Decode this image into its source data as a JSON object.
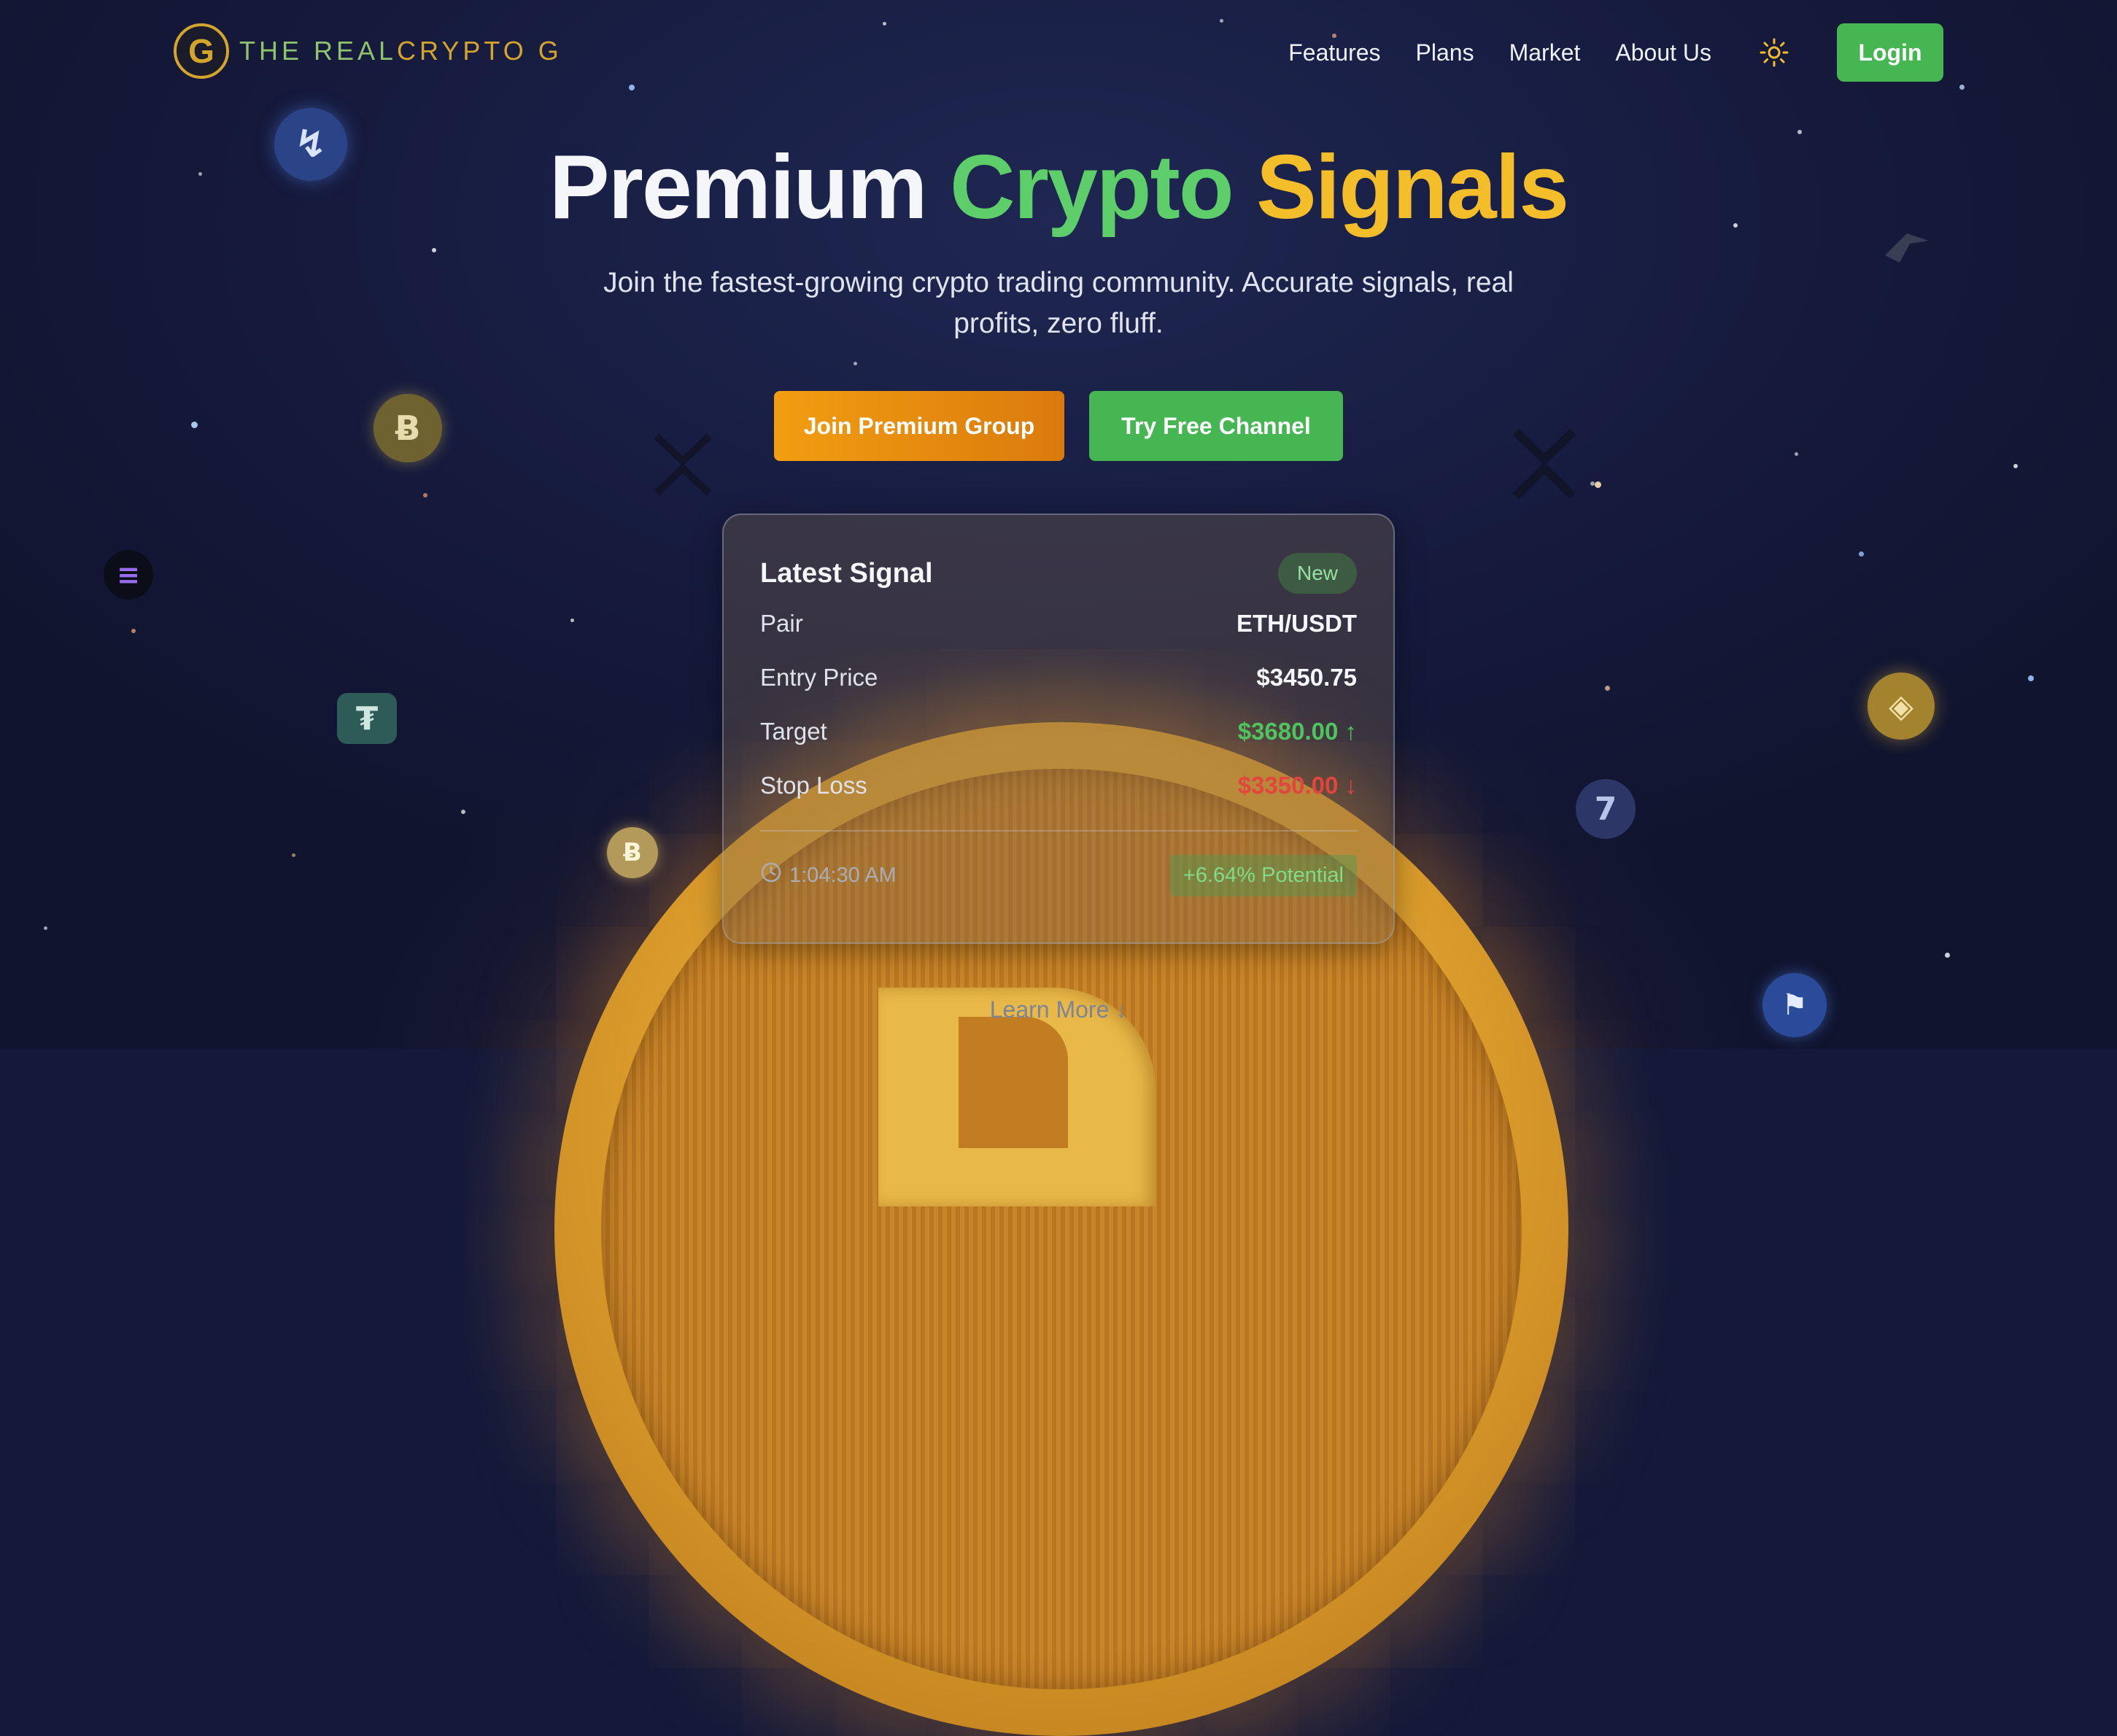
{
  "brand": {
    "logo_mark": "G",
    "name_part1": "THE REAL",
    "name_part2": "CRYPTO G"
  },
  "nav": {
    "links": [
      "Features",
      "Plans",
      "Market",
      "About Us"
    ],
    "theme_icon": "sun-icon",
    "login_label": "Login"
  },
  "hero": {
    "title_part1": "Premium",
    "title_part2": "Crypto",
    "title_part3": "Signals",
    "subtitle": "Join the fastest-growing crypto trading community. Accurate signals, real profits, zero fluff.",
    "primary_cta": "Join Premium Group",
    "secondary_cta": "Try Free Channel"
  },
  "signal": {
    "title": "Latest Signal",
    "badge": "New",
    "rows": [
      {
        "label": "Pair",
        "value": "ETH/USDT"
      },
      {
        "label": "Entry Price",
        "value": "$3450.75"
      },
      {
        "label": "Target",
        "value": "$3680.00 ↑"
      },
      {
        "label": "Stop Loss",
        "value": "$3350.00 ↓"
      }
    ],
    "time": "1:04:30 AM",
    "potential": "+6.64% Potential"
  },
  "learn_more": "Learn More ↓",
  "colors": {
    "accent_green": "#45b652",
    "accent_orange": "#f29d11",
    "accent_gold": "#f4be2b",
    "loss_red": "#e2453d"
  }
}
